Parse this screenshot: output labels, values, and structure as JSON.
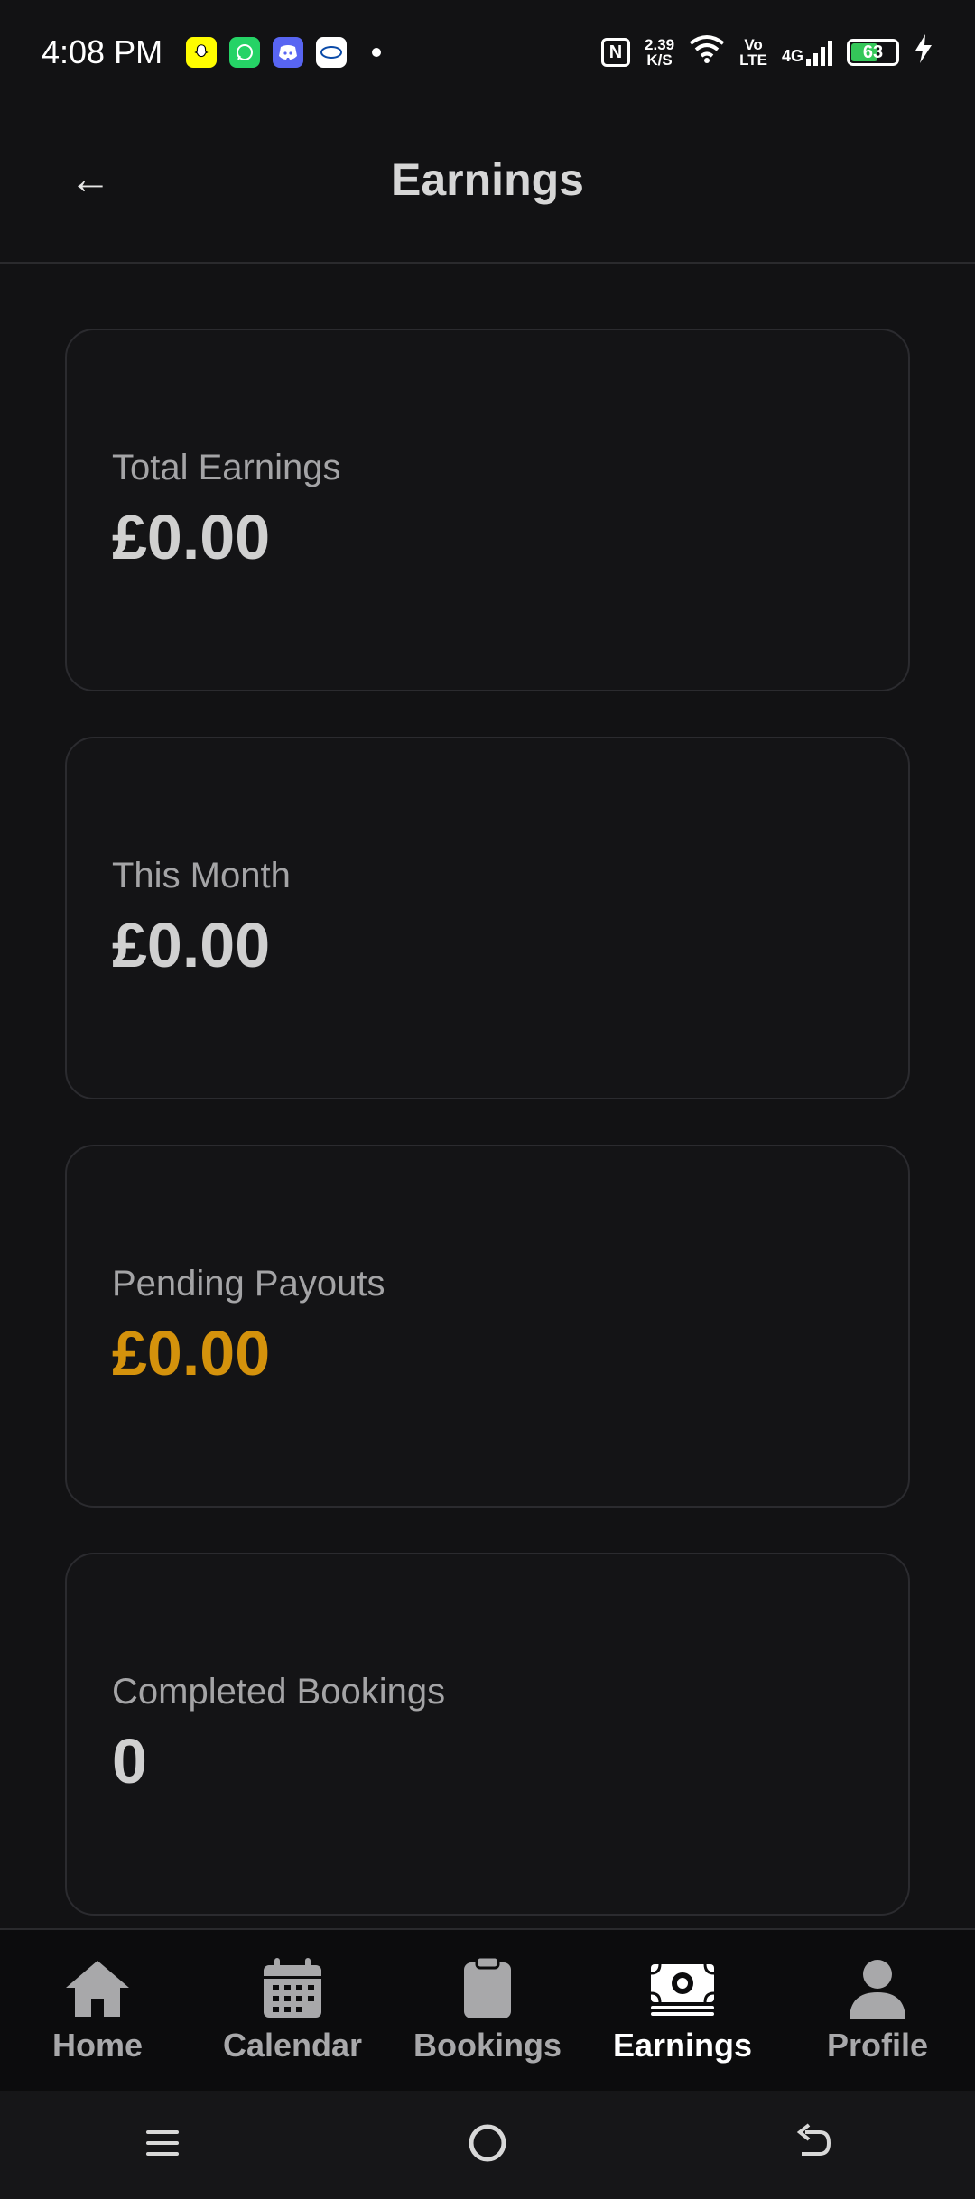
{
  "status_bar": {
    "time": "4:08 PM",
    "app_icons": [
      "snapchat-icon",
      "whatsapp-icon",
      "discord-icon",
      "ubl-icon"
    ],
    "net_speed_value": "2.39",
    "net_speed_unit": "K/S",
    "volte_top": "Vo",
    "volte_bottom": "LTE",
    "network": "4G",
    "battery_level": "63",
    "battery_color": "#34c759"
  },
  "header": {
    "back_icon": "←",
    "title": "Earnings"
  },
  "cards": [
    {
      "label": "Total Earnings",
      "value": "£0.00"
    },
    {
      "label": "This Month",
      "value": "£0.00"
    },
    {
      "label": "Pending Payouts",
      "value": "£0.00",
      "accent": "#d4920c"
    },
    {
      "label": "Completed Bookings",
      "value": "0"
    }
  ],
  "bottom_nav": {
    "items": [
      {
        "label": "Home",
        "icon": "home-icon"
      },
      {
        "label": "Calendar",
        "icon": "calendar-icon"
      },
      {
        "label": "Bookings",
        "icon": "clipboard-icon"
      },
      {
        "label": "Earnings",
        "icon": "money-icon",
        "active": true
      },
      {
        "label": "Profile",
        "icon": "profile-icon"
      }
    ]
  },
  "system_nav": {
    "buttons": [
      "menu-icon",
      "home-circle-icon",
      "back-icon"
    ]
  }
}
